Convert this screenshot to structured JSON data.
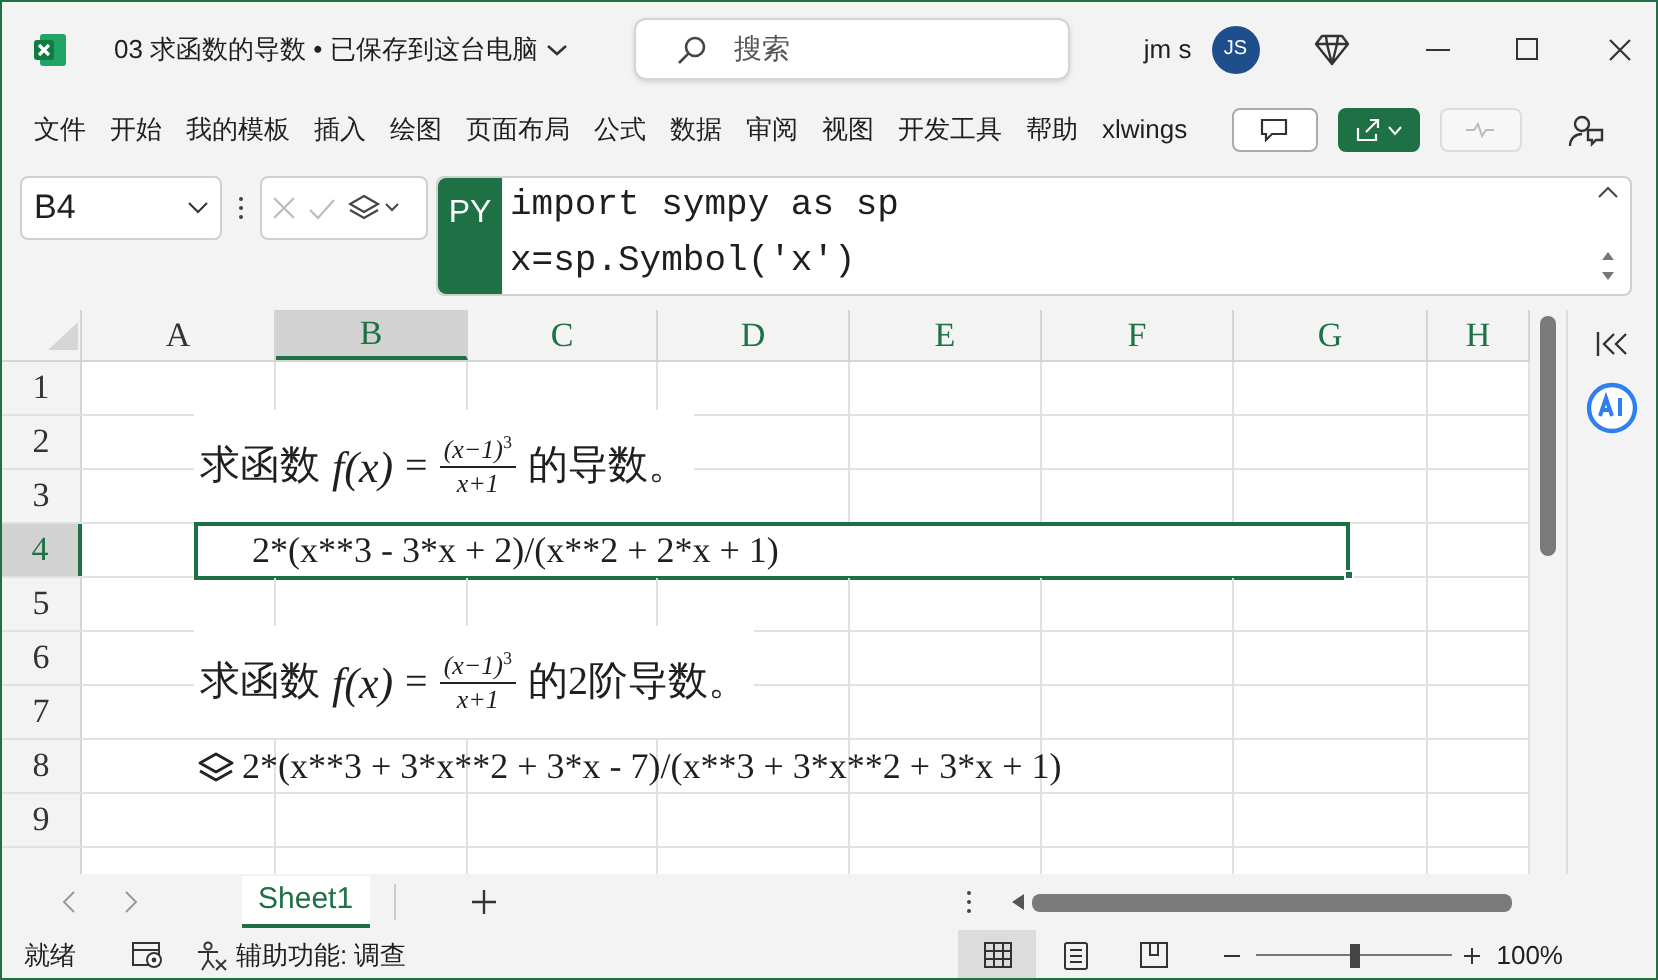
{
  "window": {
    "title": "03 求函数的导数 • 已保存到这台电脑",
    "search_placeholder": "搜索",
    "user": "jm s",
    "avatar": "JS"
  },
  "ribbon_tabs": [
    "文件",
    "开始",
    "我的模板",
    "插入",
    "绘图",
    "页面布局",
    "公式",
    "数据",
    "审阅",
    "视图",
    "开发工具",
    "帮助",
    "xlwings"
  ],
  "formula_bar": {
    "name_box": "B4",
    "badge": "PY",
    "code": [
      "import sympy as sp",
      "x=sp.Symbol('x')"
    ]
  },
  "columns": [
    {
      "label": "A",
      "selected": false
    },
    {
      "label": "B",
      "selected": true
    },
    {
      "label": "C",
      "selected": false
    },
    {
      "label": "D",
      "selected": false
    },
    {
      "label": "E",
      "selected": false
    },
    {
      "label": "F",
      "selected": false
    },
    {
      "label": "G",
      "selected": false
    },
    {
      "label": "H",
      "selected": false
    }
  ],
  "rows": [
    {
      "label": "1",
      "selected": false
    },
    {
      "label": "2",
      "selected": false,
      "formula": {
        "prefix": "求函数",
        "function": "f(x)",
        "equals": "=",
        "numerator": "(x−1)",
        "exponent": "3",
        "denominator": "x+1",
        "suffix": "的导数。"
      }
    },
    {
      "label": "3",
      "selected": false
    },
    {
      "label": "4",
      "selected": true,
      "cell": {
        "text": "2*(x**3 - 3*x + 2)/(x**2 + 2*x + 1)",
        "selected": true,
        "python_object": false
      }
    },
    {
      "label": "5",
      "selected": false
    },
    {
      "label": "6",
      "selected": false,
      "formula": {
        "prefix": "求函数",
        "function": "f(x)",
        "equals": "=",
        "numerator": "(x−1)",
        "exponent": "3",
        "denominator": "x+1",
        "suffix": "的2阶导数。"
      }
    },
    {
      "label": "7",
      "selected": false
    },
    {
      "label": "8",
      "selected": false,
      "cell": {
        "text": "2*(x**3 + 3*x**2 + 3*x - 7)/(x**3 + 3*x**2 + 3*x + 1)",
        "selected": false,
        "python_object": true
      }
    },
    {
      "label": "9",
      "selected": false
    }
  ],
  "sheet_tabs": [
    {
      "label": "Sheet1",
      "selected": true
    }
  ],
  "status_bar": {
    "ready": "就绪",
    "accessibility": "辅助功能: 调查",
    "views": [
      {
        "kind": "normal",
        "selected": true
      },
      {
        "kind": "page_layout",
        "selected": false
      },
      {
        "kind": "page_break",
        "selected": false
      }
    ],
    "zoom": {
      "level": 0.5,
      "reading": "100%"
    }
  }
}
